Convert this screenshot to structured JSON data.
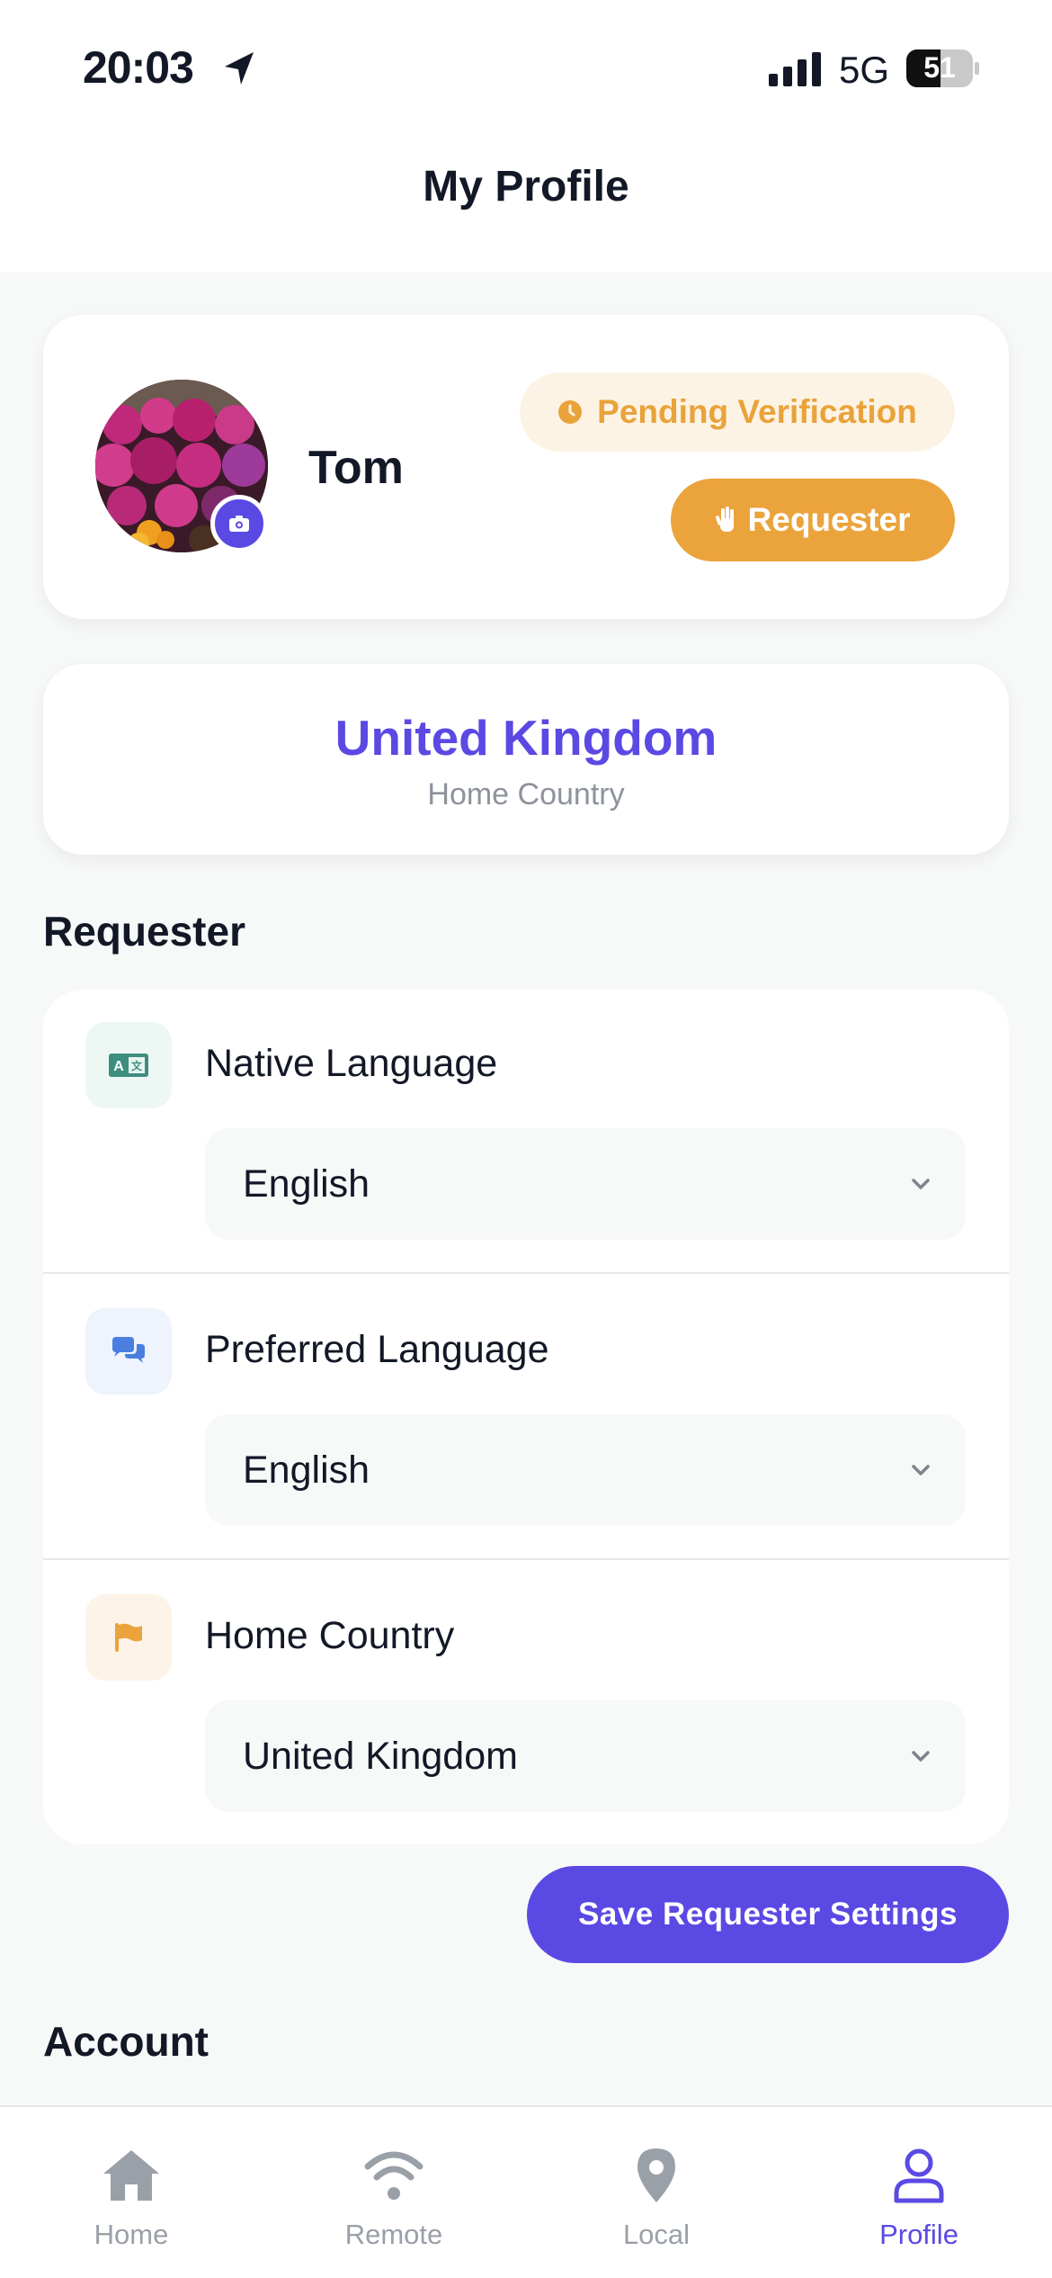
{
  "status": {
    "time": "20:03",
    "network": "5G",
    "battery": "51"
  },
  "header": {
    "title": "My Profile"
  },
  "profile": {
    "name": "Tom",
    "status_badge": "Pending Verification",
    "role_button": "Requester"
  },
  "country_card": {
    "country": "United Kingdom",
    "caption": "Home Country"
  },
  "requester_section": {
    "title": "Requester",
    "fields": [
      {
        "label": "Native Language",
        "value": "English",
        "icon": "translate-icon"
      },
      {
        "label": "Preferred Language",
        "value": "English",
        "icon": "chat-bubbles-icon"
      },
      {
        "label": "Home Country",
        "value": "United Kingdom",
        "icon": "flag-icon"
      }
    ],
    "save_button": "Save Requester Settings"
  },
  "account_section": {
    "title": "Account"
  },
  "tabbar": {
    "tabs": [
      {
        "label": "Home",
        "icon": "home-icon"
      },
      {
        "label": "Remote",
        "icon": "wifi-icon"
      },
      {
        "label": "Local",
        "icon": "map-pin-icon"
      },
      {
        "label": "Profile",
        "icon": "user-icon",
        "active": true
      }
    ]
  },
  "colors": {
    "accent": "#5b49e3",
    "warning": "#eba33b",
    "warning_bg": "#fdf3e5"
  }
}
